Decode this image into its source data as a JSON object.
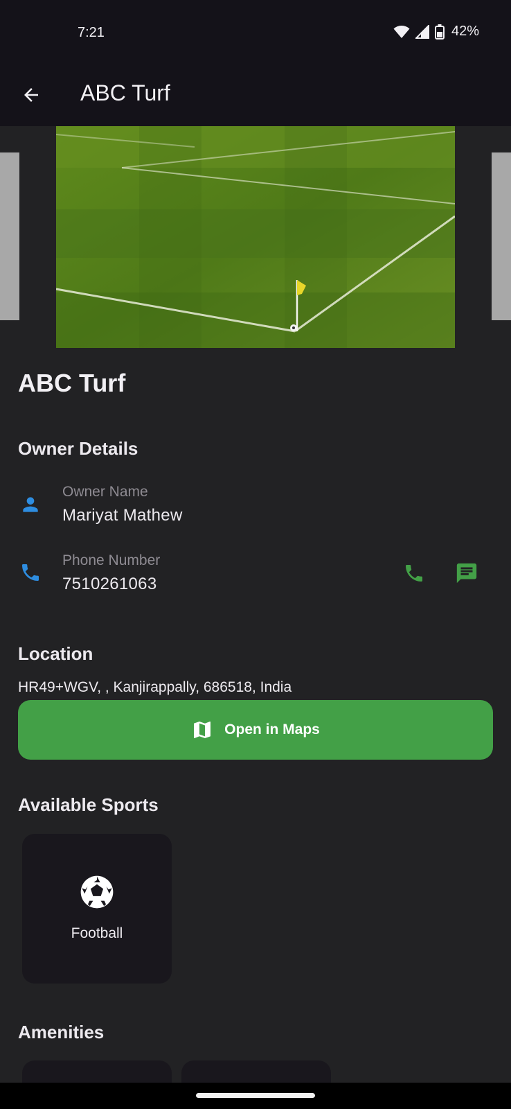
{
  "status_bar": {
    "time": "7:21",
    "battery": "42%"
  },
  "app_bar": {
    "title": "ABC Turf",
    "back_icon": "arrow-back-icon"
  },
  "carousel": {
    "image_alt": "Football pitch corner with flag and ball"
  },
  "turf": {
    "name": "ABC Turf"
  },
  "owner_section": {
    "title": "Owner Details",
    "owner_name_label": "Owner Name",
    "owner_name": "Mariyat Mathew",
    "phone_label": "Phone Number",
    "phone": "7510261063"
  },
  "location_section": {
    "title": "Location",
    "address": "HR49+WGV, , Kanjirappally, 686518, India",
    "maps_button_label": "Open in Maps"
  },
  "sports_section": {
    "title": "Available Sports",
    "sports": [
      {
        "name": "Football",
        "icon": "football-icon"
      }
    ]
  },
  "amenities_section": {
    "title": "Amenities"
  },
  "colors": {
    "background": "#222224",
    "app_bar": "#141219",
    "accent_blue": "#2e8de0",
    "accent_green": "#43a047",
    "card": "#19171d"
  }
}
